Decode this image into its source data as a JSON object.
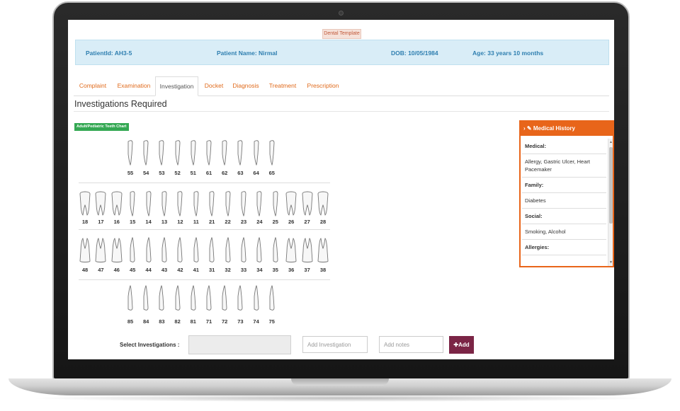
{
  "template_tag": "Dental Template",
  "patient": {
    "id": "PatientId: AH3-5",
    "name": "Patient Name: Nirmal",
    "dob": "DOB: 10/05/1984",
    "age": "Age: 33 years 10 months"
  },
  "tabs": [
    {
      "label": "Complaint"
    },
    {
      "label": "Examination"
    },
    {
      "label": "Investigation",
      "active": true
    },
    {
      "label": "Docket"
    },
    {
      "label": "Diagnosis"
    },
    {
      "label": "Treatment"
    },
    {
      "label": "Prescription"
    }
  ],
  "section_title": "Investigations Required",
  "teeth_chart_label": "Adult/Pediatric Teeth Chart",
  "teeth": {
    "upper_primary": [
      "55",
      "54",
      "53",
      "52",
      "51",
      "61",
      "62",
      "63",
      "64",
      "65"
    ],
    "upper_permanent": [
      "18",
      "17",
      "16",
      "15",
      "14",
      "13",
      "12",
      "11",
      "21",
      "22",
      "23",
      "24",
      "25",
      "26",
      "27",
      "28"
    ],
    "lower_permanent": [
      "48",
      "47",
      "46",
      "45",
      "44",
      "43",
      "42",
      "41",
      "31",
      "32",
      "33",
      "34",
      "35",
      "36",
      "37",
      "38"
    ],
    "lower_primary": [
      "85",
      "84",
      "83",
      "82",
      "81",
      "71",
      "72",
      "73",
      "74",
      "75"
    ]
  },
  "form": {
    "select_label": "Select Investigations :",
    "investigation_placeholder": "Add Investigation",
    "notes_placeholder": "Add notes",
    "add_label": "✚Add"
  },
  "medical_history": {
    "title": "Medical History",
    "rows": [
      {
        "text": "Medical:",
        "type": "label"
      },
      {
        "text": "Allergy, Gastric Ulcer, Heart Pacemaker",
        "type": "value"
      },
      {
        "text": "Family:",
        "type": "label"
      },
      {
        "text": "Diabetes",
        "type": "value"
      },
      {
        "text": "Social:",
        "type": "label"
      },
      {
        "text": "Smoking, Alcohol",
        "type": "value"
      },
      {
        "text": "Allergies:",
        "type": "label"
      }
    ]
  },
  "colors": {
    "accent": "#e8651a",
    "tab_text": "#e06a1b",
    "patient_bar_bg": "#d9edf7",
    "patient_bar_text": "#2f7fb0",
    "badge_green": "#34a853",
    "add_button": "#7b2546"
  },
  "icons": {
    "medical_history": [
      "chevron-right-icon",
      "edit-icon"
    ],
    "add_button": "plus-icon"
  }
}
